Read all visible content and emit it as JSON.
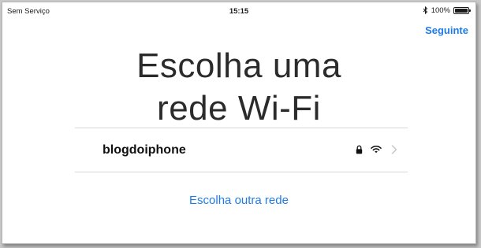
{
  "status_bar": {
    "carrier": "Sem Serviço",
    "time": "15:15",
    "battery": "100%",
    "battery_level": 1.0,
    "icons": [
      "bluetooth-icon",
      "battery-icon"
    ]
  },
  "header": {
    "next_label": "Seguinte"
  },
  "title": {
    "line1": "Escolha uma",
    "line2": "rede Wi-Fi"
  },
  "networks": [
    {
      "name": "blogdoiphone",
      "icons": [
        "lock-icon",
        "wifi-icon",
        "chevron-right-icon"
      ]
    }
  ],
  "other_network_label": "Escolha outra rede",
  "colors": {
    "accent": "#1f7ce6",
    "text": "#1a1a1a",
    "divider": "#d8d8d8",
    "icon_gray": "#c7c7cc"
  }
}
